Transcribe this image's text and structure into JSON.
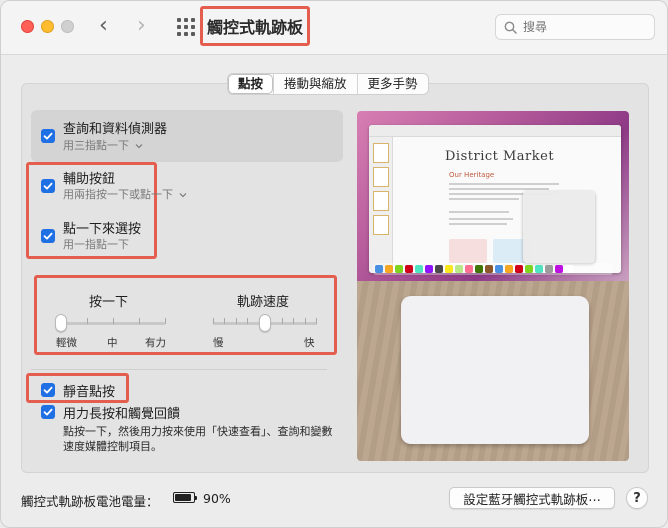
{
  "window": {
    "title": "觸控式軌跡板"
  },
  "toolbar": {
    "back_glyph": "‹",
    "forward_glyph": "›",
    "search_placeholder": "搜尋"
  },
  "tabs": [
    {
      "label": "點按",
      "active": true
    },
    {
      "label": "捲動與縮放",
      "active": false
    },
    {
      "label": "更多手勢",
      "active": false
    }
  ],
  "options": {
    "lookup": {
      "label": "查詢和資料偵測器",
      "gesture": "用三指點一下",
      "checked": true
    },
    "secondary_click": {
      "label": "輔助按鈕",
      "gesture": "用兩指按一下或點一下",
      "checked": true
    },
    "tap_to_click": {
      "label": "點一下來選按",
      "gesture": "用一指點一下",
      "checked": true
    }
  },
  "sliders": {
    "click": {
      "label": "按一下",
      "tick_labels": [
        "輕微",
        "中",
        "有力"
      ],
      "value_index": 0
    },
    "tracking_speed": {
      "label": "軌跡速度",
      "min_label": "慢",
      "max_label": "快",
      "value_fraction": 0.5
    }
  },
  "silent_click": {
    "label": "靜音點按",
    "checked": true
  },
  "force_click": {
    "label": "用力長按和觸覺回饋",
    "checked": true,
    "description": "點按一下，然後用力按來使用「快速查看」、查詢和變數速度媒體控制項目。"
  },
  "preview": {
    "doc_title": "District Market",
    "doc_heading": "Our Heritage"
  },
  "footer": {
    "battery_label": "觸控式軌跡板電池電量：",
    "battery_percent": "90%",
    "battery_level": 0.9,
    "bluetooth_button": "設定藍牙觸控式軌跡板⋯",
    "help_button": "?"
  },
  "colors": {
    "accent": "#1f6fe5",
    "annotation_red": "#e35e4f"
  }
}
